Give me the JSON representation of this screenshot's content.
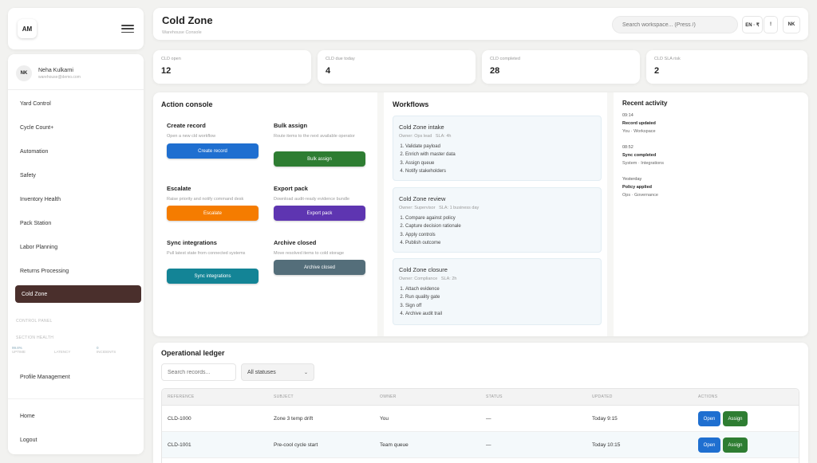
{
  "brand": {
    "logo_text": "AM"
  },
  "user": {
    "initials": "NK",
    "name": "Neha Kulkarni",
    "email": "warehouse@demo.com"
  },
  "nav": {
    "items": [
      {
        "label": "Yard Control"
      },
      {
        "label": "Cycle Count+"
      },
      {
        "label": "Automation"
      },
      {
        "label": "Safety"
      },
      {
        "label": "Inventory Health"
      },
      {
        "label": "Pack Station"
      },
      {
        "label": "Labor Planning"
      },
      {
        "label": "Returns Processing"
      },
      {
        "label": "Cold Zone",
        "active": true
      }
    ],
    "control_panel_label": "CONTROL PANEL",
    "section_health_label": "SECTION HEALTH",
    "health": [
      {
        "value": "99.8%",
        "label": "UPTIME"
      },
      {
        "value": "",
        "label": "LATENCY"
      },
      {
        "value": "0",
        "label": "INCIDENTS"
      }
    ],
    "profile_label": "Profile Management",
    "footer": [
      {
        "label": "Home"
      },
      {
        "label": "Logout"
      }
    ]
  },
  "header": {
    "title": "Cold Zone",
    "subtitle": "Warehouse Console",
    "search_placeholder": "Search workspace... (Press /)",
    "lang_label": "EN · ₹",
    "info_label": "!",
    "user_initials": "NK"
  },
  "kpis": [
    {
      "label": "CLD open",
      "value": "12"
    },
    {
      "label": "CLD due today",
      "value": "4"
    },
    {
      "label": "CLD completed",
      "value": "28"
    },
    {
      "label": "CLD SLA risk",
      "value": "2"
    }
  ],
  "actions": {
    "title": "Action console",
    "items": [
      {
        "title": "Create record",
        "desc": "Open a new cld workflow",
        "button": "Create record",
        "color": "#1f6fd0"
      },
      {
        "title": "Bulk assign",
        "desc": "Route items to the next available operator",
        "button": "Bulk assign",
        "color": "#2e7d32"
      },
      {
        "title": "Escalate",
        "desc": "Raise priority and notify command desk",
        "button": "Escalate",
        "color": "#f57c00"
      },
      {
        "title": "Export pack",
        "desc": "Download audit-ready evidence bundle",
        "button": "Export pack",
        "color": "#5e35b1"
      },
      {
        "title": "Sync integrations",
        "desc": "Pull latest state from connected systems",
        "button": "Sync integrations",
        "color": "#138496"
      },
      {
        "title": "Archive closed",
        "desc": "Move resolved items to cold storage",
        "button": "Archive closed",
        "color": "#546e7a"
      }
    ]
  },
  "workflows": {
    "title": "Workflows",
    "items": [
      {
        "title": "Cold Zone intake",
        "owner": "Owner: Ops lead",
        "sla": "SLA: 4h",
        "steps": [
          "Validate payload",
          "Enrich with master data",
          "Assign queue",
          "Notify stakeholders"
        ]
      },
      {
        "title": "Cold Zone review",
        "owner": "Owner: Supervisor",
        "sla": "SLA: 1 business day",
        "steps": [
          "Compare against policy",
          "Capture decision rationale",
          "Apply controls",
          "Publish outcome"
        ]
      },
      {
        "title": "Cold Zone closure",
        "owner": "Owner: Compliance",
        "sla": "SLA: 2h",
        "steps": [
          "Attach evidence",
          "Run quality gate",
          "Sign off",
          "Archive audit trail"
        ]
      }
    ]
  },
  "activity": {
    "title": "Recent activity",
    "items": [
      {
        "time": "09:14",
        "title": "Record updated",
        "sub": "You · Workspace"
      },
      {
        "time": "08:52",
        "title": "Sync completed",
        "sub": "System · Integrations"
      },
      {
        "time": "Yesterday",
        "title": "Policy applied",
        "sub": "Ops · Governance"
      }
    ]
  },
  "ledger": {
    "title": "Operational ledger",
    "search_placeholder": "Search records...",
    "status_filter": "All statuses",
    "columns": [
      "REFERENCE",
      "SUBJECT",
      "OWNER",
      "STATUS",
      "UPDATED",
      "ACTIONS"
    ],
    "rows": [
      {
        "ref": "CLD-1000",
        "subject": "Zone 3 temp drift",
        "owner": "You",
        "status": "—",
        "updated": "Today 9:15",
        "open": "Open",
        "assign": "Assign"
      },
      {
        "ref": "CLD-1001",
        "subject": "Pre-cool cycle start",
        "owner": "Team queue",
        "status": "—",
        "updated": "Today 10:15",
        "open": "Open",
        "assign": "Assign"
      }
    ]
  },
  "colors": {
    "active_nav": "#4a2f2c",
    "open_button": "#1f6fd0",
    "assign_button": "#2e7d32"
  }
}
